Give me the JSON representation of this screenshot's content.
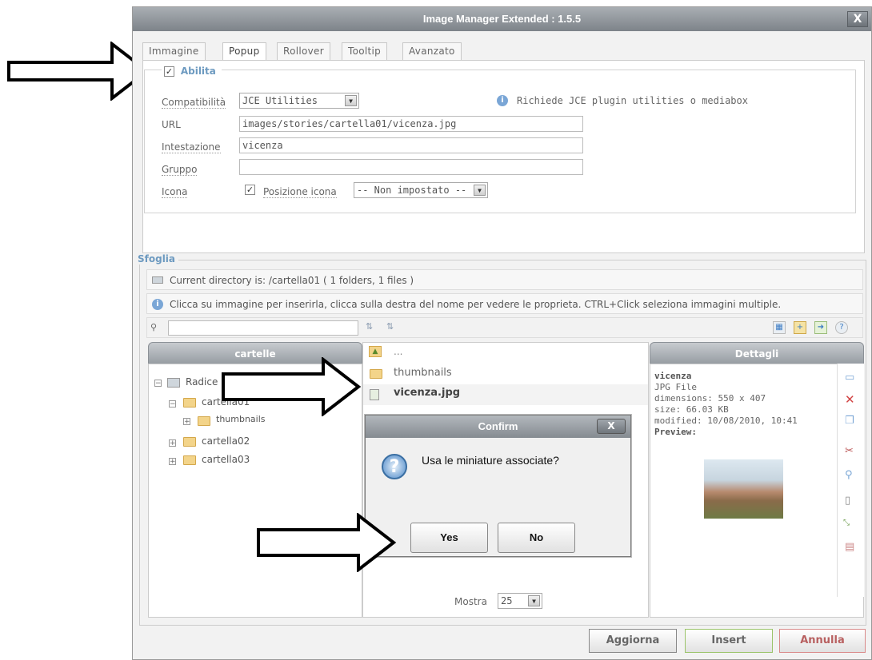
{
  "window": {
    "title": "Image Manager Extended : 1.5.5",
    "close_label": "X"
  },
  "tabs": [
    "Immagine",
    "Popup",
    "Rollover",
    "Tooltip",
    "Avanzato"
  ],
  "popup": {
    "enable_label": "Abilita",
    "enabled": true,
    "compat_label": "Compatibilità",
    "compat_value": "JCE Utilities",
    "compat_note": "Richiede JCE plugin utilities o mediabox",
    "url_label": "URL",
    "url_value": "images/stories/cartella01/vicenza.jpg",
    "heading_label": "Intestazione",
    "heading_value": "vicenza",
    "group_label": "Gruppo",
    "group_value": "",
    "icon_label": "Icona",
    "icon_checked": true,
    "icon_pos_label": "Posizione icona",
    "icon_pos_value": "-- Non impostato --"
  },
  "browser": {
    "legend": "Sfoglia",
    "current_dir": "Current directory is: /cartella01 ( 1 folders, 1 files )",
    "hint": "Clicca su immagine per inserirla, clicca sulla destra del nome per vedere le proprieta. CTRL+Click seleziona immagini multiple.",
    "search_value": "",
    "folders_header": "cartelle",
    "tree": {
      "root": "Radice",
      "folder1": "cartella01",
      "sub": "thumbnails",
      "folder2": "cartella02",
      "folder3": "cartella03"
    },
    "files": {
      "up": "...",
      "item1": "thumbnails",
      "item2": "vicenza.jpg"
    },
    "details_header": "Dettagli",
    "details": {
      "name": "vicenza",
      "type": "JPG File",
      "dimensions": "dimensions: 550 x 407",
      "size": "size: 66.03 KB",
      "modified": "modified: 10/08/2010, 10:41",
      "preview": "Preview:"
    },
    "show_label": "Mostra",
    "show_value": "25"
  },
  "confirm": {
    "title": "Confirm",
    "message": "Usa le miniature associate?",
    "yes": "Yes",
    "no": "No",
    "close": "X"
  },
  "footer": {
    "refresh": "Aggiorna",
    "insert": "Insert",
    "cancel": "Annulla"
  },
  "colors": {
    "accent_blue": "#6d9ac0",
    "insert_green": "#9bc46a",
    "cancel_red": "#d98a8a"
  }
}
